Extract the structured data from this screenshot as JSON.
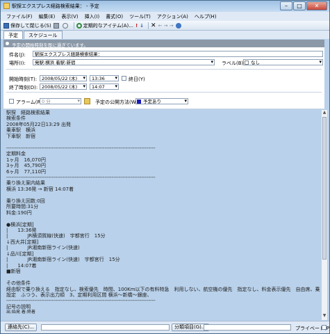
{
  "window": {
    "title": "駅探エクスプレス経路検索結果： - 予定",
    "minimize": "–",
    "maximize": "□",
    "close": "✕"
  },
  "menu": [
    "ファイル(F)",
    "編集(E)",
    "表示(V)",
    "挿入(I)",
    "書式(O)",
    "ツール(T)",
    "アクション(A)",
    "ヘルプ(H)"
  ],
  "toolbar": {
    "save_close": "保存して閉じる(S)",
    "recurrence": "定期的なアイテム(A)...",
    "arrows": "← → →"
  },
  "tabs": [
    "予定",
    "スケジュール"
  ],
  "info_bar": "予定の開始時刻を既に過ぎています。",
  "form": {
    "subject_label": "件名(J):",
    "subject_value": "駅探エクスプレス経路検索結果：",
    "location_label": "場所(I):",
    "location_value": "発駅:横浜 着駅:新宿",
    "label_label": "ラベル(B):",
    "label_value": "なし",
    "start_label": "開始時刻(T):",
    "start_date": "2008/05/22 (木)",
    "start_time": "13:36",
    "allday_label": "終日(Y)",
    "end_label": "終了時刻(D):",
    "end_date": "2008/05/22 (木)",
    "end_time": "14:07",
    "alarm_label": "アラーム(R):",
    "alarm_value": "0 分",
    "showas_label": "予定の公開方法(W):",
    "showas_value": "予定あり",
    "showas_color": "#1a1ab8"
  },
  "body_lines": [
    "駅探　経路検索結果",
    "検索条件",
    "2008年05月22日13:29 出発",
    "乗車駅　横浜",
    "下車駅　新宿",
    "",
    "-------------------------------------------------------------------------------------",
    "定期料金",
    "1ヶ月　16,070円",
    "3ヶ月　45,790円",
    "6ヶ月　77,110円",
    "-------------------------------------------------------------------------------------",
    "乗り換え案内結果",
    "横浜 13:36発 → 新宿 14:07着",
    "",
    "乗り換え回数:0回",
    "所要時間:31分",
    "料金:190円",
    "",
    "●横浜[定期]",
    "|　　13:36発",
    "|　　　　JR横須賀線(快速)　宇都宮行　15分",
    "↓西大井[定期]",
    "|　　　　JR湘南新宿ライン(快速)",
    "↓品川[定期]",
    "|　　　　JR湘南新宿ライン(快速)　宇都宮行　15分",
    "|　　14:07着",
    "■新宿",
    "",
    "その他条件",
    "経由駅で乗り換える　指定なし、検索優先　時間、100Km以下の有料特急　利用しない、航空機の優先　指定なし、料金表示優先　自由席、乗り換え待ち時間の",
    "設定　ふつう、表示出力順　3、定期利用区間 横浜〜新橋〜銀座、",
    "-------------------------------------------------------------------------------------",
    "記号の説明",
    "出:始発 着:終着"
  ],
  "bottom": {
    "contacts_button": "連絡先(C)...",
    "categories_button": "分類項目(G)...",
    "private_label": "プライベート(P)"
  }
}
